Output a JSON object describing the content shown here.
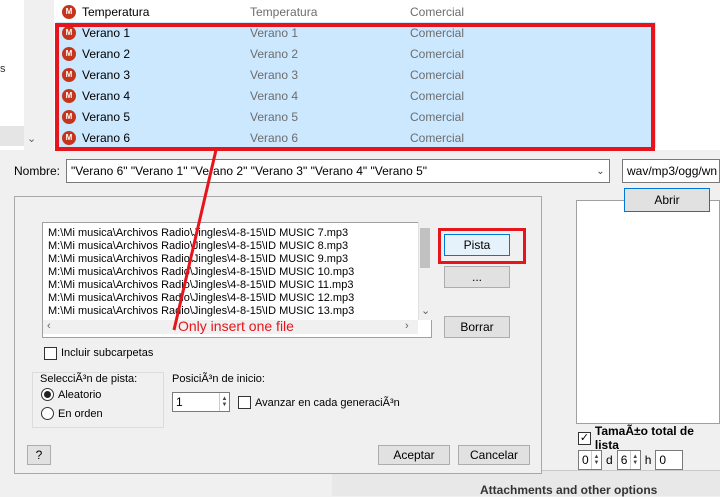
{
  "file_dialog": {
    "nav_partial_text": "s",
    "files": [
      {
        "name": "Temperatura",
        "title": "Temperatura",
        "genre": "Comercial",
        "selected": false
      },
      {
        "name": "Verano 1",
        "title": "Verano 1",
        "genre": "Comercial",
        "selected": true
      },
      {
        "name": "Verano 2",
        "title": "Verano 2",
        "genre": "Comercial",
        "selected": true
      },
      {
        "name": "Verano 3",
        "title": "Verano 3",
        "genre": "Comercial",
        "selected": true
      },
      {
        "name": "Verano 4",
        "title": "Verano 4",
        "genre": "Comercial",
        "selected": true
      },
      {
        "name": "Verano 5",
        "title": "Verano 5",
        "genre": "Comercial",
        "selected": true
      },
      {
        "name": "Verano 6",
        "title": "Verano 6",
        "genre": "Comercial",
        "selected": true
      }
    ],
    "file_icon_letter": "M",
    "nombre_label": "Nombre:",
    "nombre_value": "\"Verano 6\" \"Verano 1\" \"Verano 2\" \"Verano 3\" \"Verano 4\" \"Verano 5\"",
    "filter_value": "wav/mp3/ogg/wn",
    "open_button": "Abrir"
  },
  "track_dialog": {
    "file_paths": [
      "M:\\Mi musica\\Archivos Radio\\Jingles\\4-8-15\\ID MUSIC 7.mp3",
      "M:\\Mi musica\\Archivos Radio\\Jingles\\4-8-15\\ID MUSIC 8.mp3",
      "M:\\Mi musica\\Archivos Radio\\Jingles\\4-8-15\\ID MUSIC 9.mp3",
      "M:\\Mi musica\\Archivos Radio\\Jingles\\4-8-15\\ID MUSIC 10.mp3",
      "M:\\Mi musica\\Archivos Radio\\Jingles\\4-8-15\\ID MUSIC 11.mp3",
      "M:\\Mi musica\\Archivos Radio\\Jingles\\4-8-15\\ID MUSIC 12.mp3",
      "M:\\Mi musica\\Archivos Radio\\Jingles\\4-8-15\\ID MUSIC 13.mp3"
    ],
    "pista_button": "Pista",
    "dots_button": "...",
    "borrar_button": "Borrar",
    "include_subfolders": "Incluir subcarpetas",
    "track_selection_legend": "SelecciÃ³n de pista:",
    "random_label": "Aleatorio",
    "in_order_label": "En orden",
    "random_selected": true,
    "start_position_label": "PosiciÃ³n de inicio:",
    "start_position_value": "1",
    "advance_label": "Avanzar en cada generaciÃ³n",
    "help_button": "?",
    "accept_button": "Aceptar",
    "cancel_button": "Cancelar"
  },
  "background_window": {
    "total_size_label": "TamaÃ±o total de lista",
    "total_size_checked": true,
    "days_value": "0",
    "days_unit": "d",
    "hours_value": "6",
    "hours_unit": "h",
    "minutes_value": "0",
    "attachments_text": "Attachments and other options"
  },
  "annotation": {
    "text": "Only insert one file",
    "color": "#e8141b"
  }
}
